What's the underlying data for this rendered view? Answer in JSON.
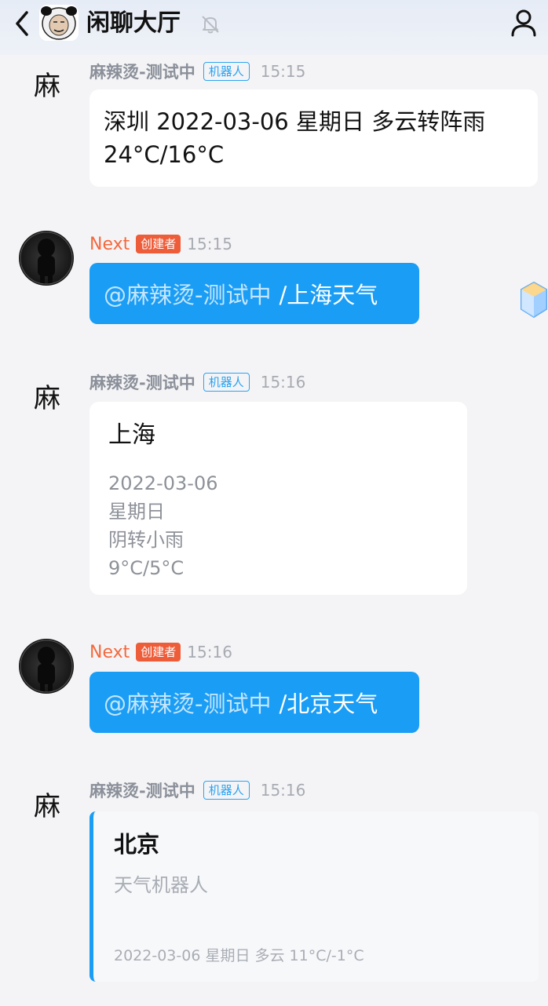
{
  "header": {
    "title": "闲聊大厅"
  },
  "messages": [
    {
      "sender": "麻辣烫-测试中",
      "avatar_char": "麻",
      "tag": "机器人",
      "time": "15:15",
      "text_line1": "深圳 2022-03-06 星期日 多云转阵雨",
      "text_line2": "24°C/16°C"
    },
    {
      "sender": "Next",
      "tag": "创建者",
      "time": "15:15",
      "mention": "@麻辣烫-测试中",
      "command": "/上海天气"
    },
    {
      "sender": "麻辣烫-测试中",
      "avatar_char": "麻",
      "tag": "机器人",
      "time": "15:16",
      "city": "上海",
      "date": "2022-03-06",
      "weekday": "星期日",
      "weather": "阴转小雨",
      "temp": "9°C/5°C"
    },
    {
      "sender": "Next",
      "tag": "创建者",
      "time": "15:16",
      "mention": "@麻辣烫-测试中",
      "command": "/北京天气"
    },
    {
      "sender": "麻辣烫-测试中",
      "avatar_char": "麻",
      "tag": "机器人",
      "time": "15:16",
      "card_title": "北京",
      "card_subtitle": "天气机器人",
      "card_footer": "2022-03-06 星期日 多云 11°C/-1°C"
    }
  ],
  "colors": {
    "accent_blue": "#1a9df5",
    "creator_orange": "#f4683d",
    "bot_tag_blue": "#2aa3f1",
    "card_bar_blue": "#1a9df5"
  },
  "icons": {
    "back": "chevron-left-icon",
    "mute": "bell-off-icon",
    "profile": "person-icon",
    "floater": "cube-icon"
  }
}
